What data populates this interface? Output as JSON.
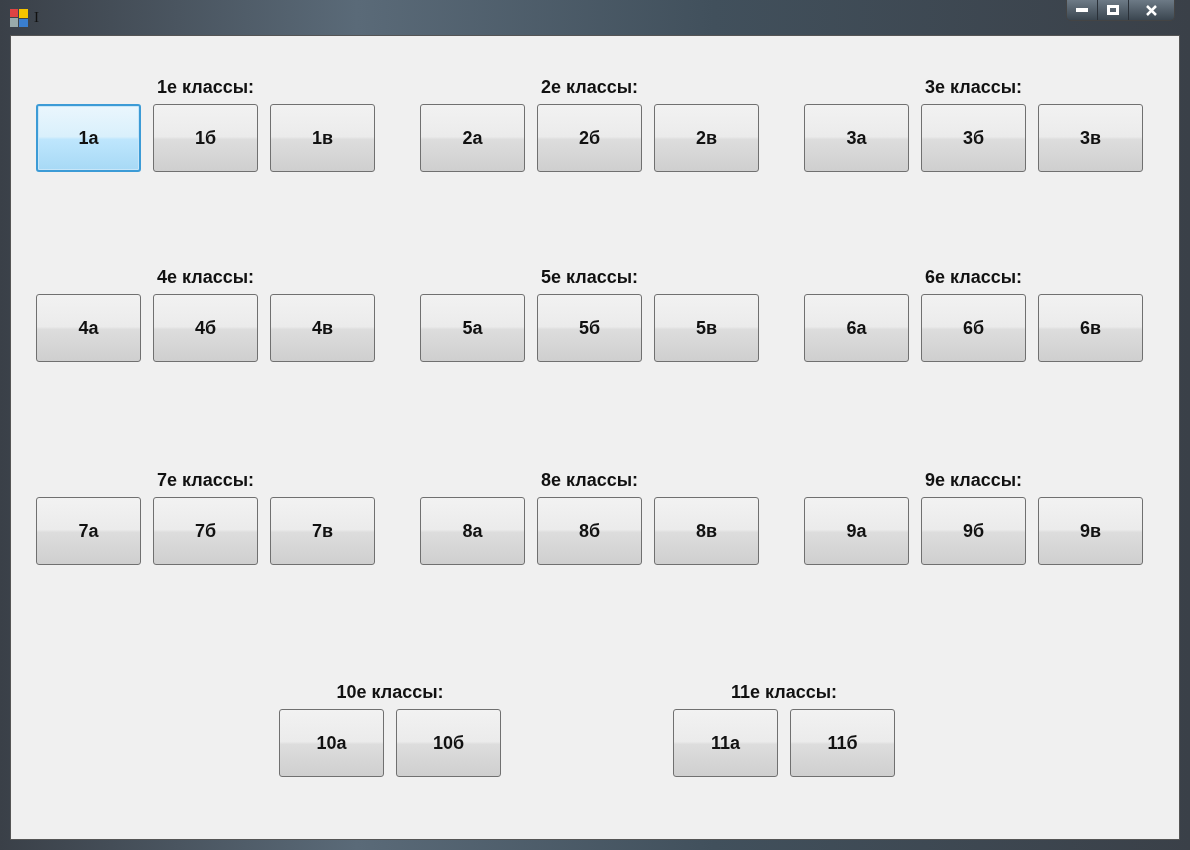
{
  "window": {
    "title": "I"
  },
  "rows": [
    {
      "groups": [
        {
          "label": "1е классы:",
          "buttons": [
            {
              "label": "1а",
              "focused": true
            },
            {
              "label": "1б",
              "focused": false
            },
            {
              "label": "1в",
              "focused": false
            }
          ]
        },
        {
          "label": "2е классы:",
          "buttons": [
            {
              "label": "2а",
              "focused": false
            },
            {
              "label": "2б",
              "focused": false
            },
            {
              "label": "2в",
              "focused": false
            }
          ]
        },
        {
          "label": "3е классы:",
          "buttons": [
            {
              "label": "3а",
              "focused": false
            },
            {
              "label": "3б",
              "focused": false
            },
            {
              "label": "3в",
              "focused": false
            }
          ]
        }
      ]
    },
    {
      "groups": [
        {
          "label": "4е классы:",
          "buttons": [
            {
              "label": "4а",
              "focused": false
            },
            {
              "label": "4б",
              "focused": false
            },
            {
              "label": "4в",
              "focused": false
            }
          ]
        },
        {
          "label": "5е классы:",
          "buttons": [
            {
              "label": "5а",
              "focused": false
            },
            {
              "label": "5б",
              "focused": false
            },
            {
              "label": "5в",
              "focused": false
            }
          ]
        },
        {
          "label": "6е классы:",
          "buttons": [
            {
              "label": "6а",
              "focused": false
            },
            {
              "label": "6б",
              "focused": false
            },
            {
              "label": "6в",
              "focused": false
            }
          ]
        }
      ]
    },
    {
      "groups": [
        {
          "label": "7е классы:",
          "buttons": [
            {
              "label": "7а",
              "focused": false
            },
            {
              "label": "7б",
              "focused": false
            },
            {
              "label": "7в",
              "focused": false
            }
          ]
        },
        {
          "label": "8е классы:",
          "buttons": [
            {
              "label": "8а",
              "focused": false
            },
            {
              "label": "8б",
              "focused": false
            },
            {
              "label": "8в",
              "focused": false
            }
          ]
        },
        {
          "label": "9е классы:",
          "buttons": [
            {
              "label": "9а",
              "focused": false
            },
            {
              "label": "9б",
              "focused": false
            },
            {
              "label": "9в",
              "focused": false
            }
          ]
        }
      ]
    },
    {
      "groups": [
        {
          "label": "10е классы:",
          "buttons": [
            {
              "label": "10а",
              "focused": false
            },
            {
              "label": "10б",
              "focused": false
            }
          ]
        },
        {
          "label": "11е классы:",
          "buttons": [
            {
              "label": "11а",
              "focused": false
            },
            {
              "label": "11б",
              "focused": false
            }
          ]
        }
      ]
    }
  ]
}
